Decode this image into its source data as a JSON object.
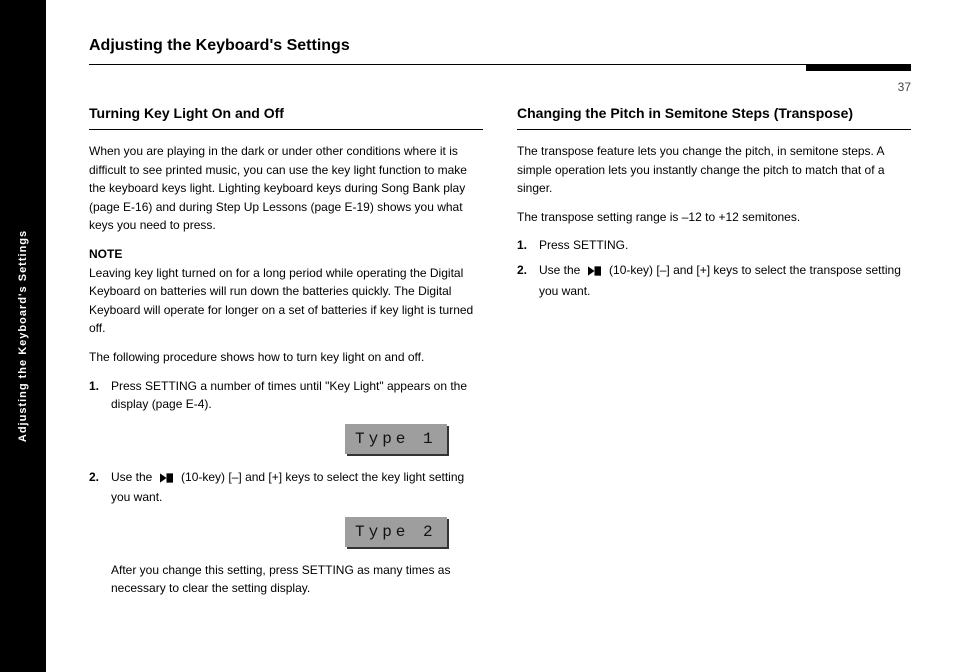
{
  "sidebar": {
    "label": "Adjusting the Keyboard's Settings"
  },
  "header": {
    "title": "Adjusting the Keyboard's Settings",
    "page_number": "37"
  },
  "left": {
    "heading": "Turning Key Light On and Off",
    "p1": "When you are playing in the dark or under other conditions where it is difficult to see printed music, you can use the key light function to make the keyboard keys light. Lighting keyboard keys during Song Bank play (page E-16) and during Step Up Lessons (page E-19) shows you what keys you need to press.",
    "note_label": "NOTE",
    "p2": "Leaving key light turned on for a long period while operating the Digital Keyboard on batteries will run down the batteries quickly. The Digital Keyboard will operate for longer on a set of batteries if key light is turned off.",
    "p3": "The following procedure shows how to turn key light on and off.",
    "step1_label": "1.",
    "step1_text": "Press SETTING a number of times until \"Key Light\" appears on the display (page E-4).",
    "lcd1": "Type  1",
    "step2_label": "2.",
    "step2_text_a": "Use the ",
    "step2_text_b": " (10-key) [–] and [+] keys to select the key light setting you want.",
    "lcd2": "Type  2",
    "step2_sub": "After you change this setting, press SETTING as many times as necessary to clear the setting display."
  },
  "right": {
    "heading": "Changing the Pitch in Semitone Steps (Transpose)",
    "p1": "The transpose feature lets you change the pitch, in semitone steps. A simple operation lets you instantly change the pitch to match that of a singer.",
    "p2": "The transpose setting range is –12 to +12 semitones.",
    "step1_label": "1.",
    "step1_text": "Press SETTING.",
    "step2_label": "2.",
    "step2_text_a": "Use the ",
    "step2_text_b": " (10-key) [–] and [+] keys to select the transpose setting you want."
  }
}
